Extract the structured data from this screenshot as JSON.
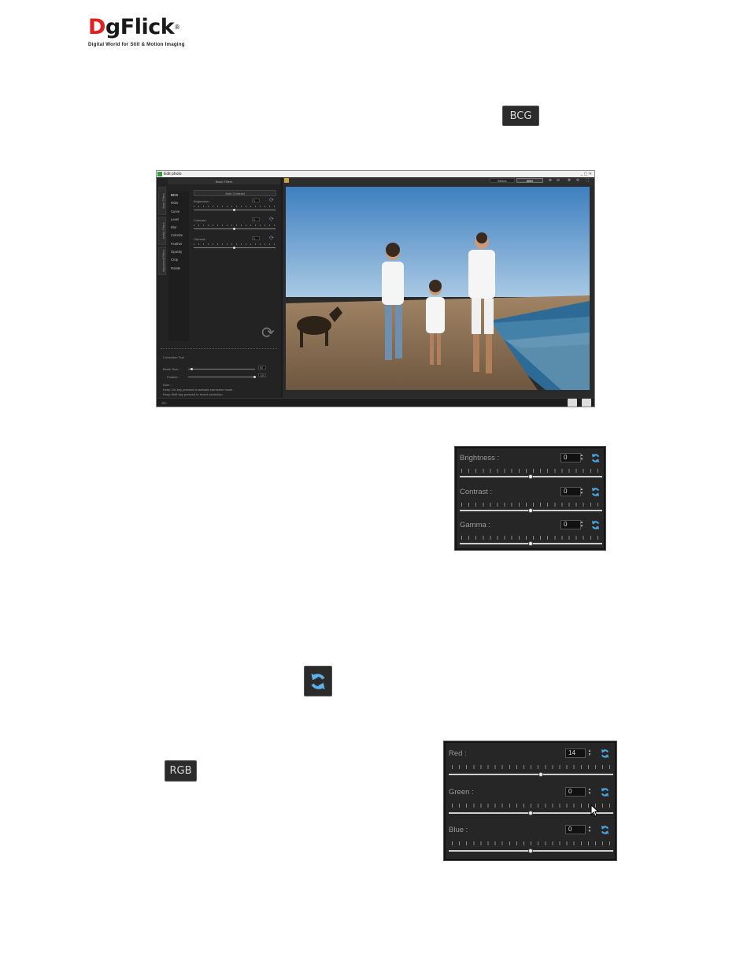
{
  "logo": {
    "brand_d": "D",
    "brand_rest": "gFlick",
    "registered": "®",
    "tagline": "Digital World for Still & Motion Imaging"
  },
  "chips": {
    "bcg": "BCG",
    "rgb": "RGB",
    "refresh_icon": "refresh-icon"
  },
  "window": {
    "title": "Edit photo",
    "controls": "_ ▢ ✕",
    "left_header": "Basic Filters",
    "vertical_tabs": [
      "Basic Filters",
      "Artistic Filters",
      "Adjustment Filters"
    ],
    "filters": [
      "BCG",
      "RGB",
      "Curve",
      "Level",
      "Blur",
      "Colorize",
      "Feather",
      "Opacity",
      "Crop",
      "Rotate"
    ],
    "auto_contrast": "Auto Contrast",
    "rows": [
      {
        "label": "Brightness :",
        "value": "0",
        "level": 0.5
      },
      {
        "label": "Contrast :",
        "value": "0",
        "level": 0.5
      },
      {
        "label": "Gamma :",
        "value": "0",
        "level": 0.5
      }
    ],
    "correction": {
      "title": "Correction Tool",
      "brush_label": "Brush Size :",
      "brush_value": "50",
      "feather_label": "Feather :",
      "feather_value": "100",
      "note_label": "Note :",
      "note_1": "Keep Ctrl key pressed to activate correction mode.",
      "note_2": "Keep Shift key pressed to revert correction."
    },
    "toolbar": {
      "before": "Before",
      "after": "After"
    }
  },
  "bcg_panel": {
    "rows": [
      {
        "label": "Brightness :",
        "value": "0",
        "level": 0.5
      },
      {
        "label": "Contrast :",
        "value": "0",
        "level": 0.5
      },
      {
        "label": "Gamma :",
        "value": "0",
        "level": 0.5
      }
    ]
  },
  "rgb_panel": {
    "rows": [
      {
        "label": "Red :",
        "value": "14",
        "level": 0.56
      },
      {
        "label": "Green :",
        "value": "0",
        "level": 0.5
      },
      {
        "label": "Blue :",
        "value": "0",
        "level": 0.5
      }
    ]
  },
  "colors": {
    "panel_bg": "#262626",
    "accent_blue": "#4aa3df",
    "brand_red": "#e02020"
  }
}
